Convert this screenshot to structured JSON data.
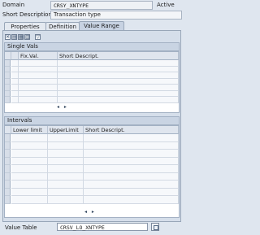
{
  "header": {
    "domain_label": "Domain",
    "domain_value": "CRSY_XNTYPE",
    "status": "Active",
    "short_desc_label": "Short Description",
    "short_desc_value": "Transaction type"
  },
  "tabs": [
    {
      "label": "Properties",
      "active": false
    },
    {
      "label": "Definition",
      "active": false
    },
    {
      "label": "Value Range",
      "active": true
    }
  ],
  "toolbar": {
    "icons": [
      "select-all-icon",
      "copy-icon",
      "paste-icon",
      "insert-row-icon",
      "filter-icon"
    ]
  },
  "single_vals": {
    "title": "Single Vals",
    "columns": [
      "",
      "Fix.Val.",
      "Short Descript."
    ],
    "first_row_number": "1",
    "row_count": 7
  },
  "intervals": {
    "title": "Intervals",
    "columns": [
      "Lower limit",
      "UpperLimit",
      "Short Descript."
    ],
    "row_count": 9
  },
  "value_table": {
    "label": "Value Table",
    "value": "CRSV_LO_XNTYPE"
  }
}
